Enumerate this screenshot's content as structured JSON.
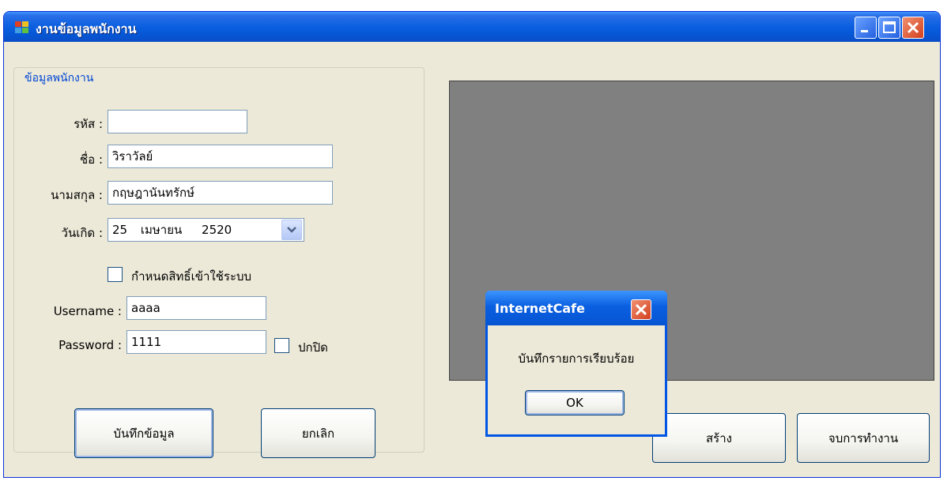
{
  "window": {
    "title": "งานข้อมูลพนักงาน"
  },
  "group": {
    "title": "ข้อมูลพนักงาน"
  },
  "form": {
    "code_label": "รหัส :",
    "code_value": "",
    "name_label": "ชื่อ :",
    "name_value": "วิราวัลย์",
    "surname_label": "นามสกุล :",
    "surname_value": "กฤษฎานันทรักษ์",
    "birthdate_label": "วันเกิด :",
    "birth_day": "25",
    "birth_month": "เมษายน",
    "birth_year": "2520",
    "access_checkbox_label": "กำหนดสิทธิ์เข้าใช้ระบบ",
    "access_checked": false,
    "username_label": "Username :",
    "username_value": "aaaa",
    "password_label": "Password :",
    "password_value": "1111",
    "hide_checkbox_label": "ปกปิด",
    "hide_checked": false
  },
  "buttons": {
    "save": "บันทึกข้อมูล",
    "cancel": "ยกเลิก",
    "create": "สร้าง",
    "exit": "จบการทำงาน"
  },
  "dialog": {
    "title": "InternetCafe",
    "message": "บันทึกรายการเรียบร้อย",
    "ok": "OK"
  },
  "colors": {
    "window_bg": "#ece9d8",
    "titlebar": "#0a5fe0",
    "preview_bg": "#808080",
    "group_title": "#0046d5"
  }
}
